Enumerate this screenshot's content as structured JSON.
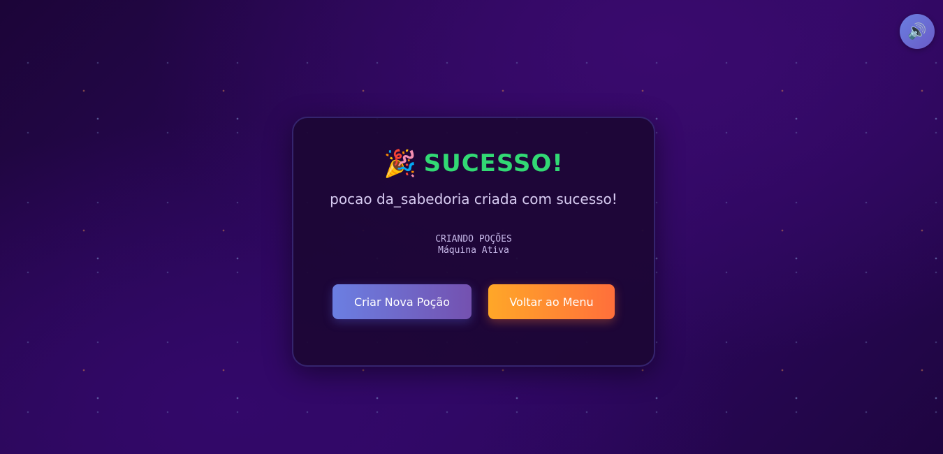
{
  "sound_toggle": {
    "icon": "speaker-icon",
    "glyph": "🔊"
  },
  "modal": {
    "title_emoji": "🎉",
    "title_icon": "party-popper-icon",
    "title": "SUCESSO!",
    "message": "pocao da_sabedoria criada com sucesso!",
    "status_line1": "CRIANDO POÇÕES",
    "status_line2": "Máquina Ativa",
    "primary_button": "Criar Nova Poção",
    "secondary_button": "Voltar ao Menu"
  },
  "colors": {
    "title_green": "#32d974",
    "primary_gradient": [
      "#6b7fe2",
      "#7451b0"
    ],
    "secondary_gradient": [
      "#ffa728",
      "#ff6f3b"
    ],
    "background": "#2a0758"
  }
}
